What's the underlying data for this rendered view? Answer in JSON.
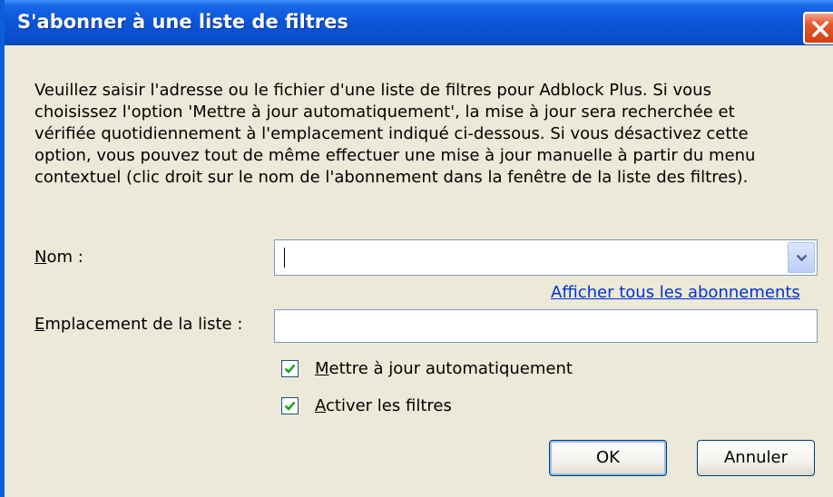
{
  "window": {
    "title": "S'abonner à une liste de filtres"
  },
  "description": {
    "lines": [
      "Veuillez saisir l'adresse ou le fichier d'une liste de filtres pour Adblock Plus. Si vous",
      "choisissez l'option 'Mettre à jour automatiquement', la mise à jour sera recherchée et",
      "vérifiée quotidiennement à l'emplacement indiqué ci-dessous. Si vous désactivez cette",
      "option, vous pouvez tout de même effectuer une mise à jour manuelle à partir du menu",
      "contextuel (clic droit sur le nom de l'abonnement dans la fenêtre de la liste des filtres)."
    ]
  },
  "form": {
    "name_label_accel": "N",
    "name_label_rest": "om :",
    "name_value": "",
    "show_all_link": "Afficher tous les abonnements",
    "location_label_accel": "E",
    "location_label_rest": "mplacement de la liste :",
    "location_value": ""
  },
  "options": {
    "auto_update": {
      "accel": "M",
      "rest": "ettre à jour automatiquement",
      "checked": true
    },
    "enable_filters": {
      "accel": "A",
      "rest": "ctiver les filtres",
      "checked": true
    }
  },
  "buttons": {
    "ok": "OK",
    "cancel": "Annuler"
  },
  "icons": {
    "close": "close-icon",
    "dropdown": "chevron-down-icon",
    "check": "checkmark-icon"
  },
  "colors": {
    "titlebar": "#0a55d7",
    "dialog_bg": "#ece9d8",
    "link": "#0033cc",
    "check": "#21a121",
    "close_button": "#e45a30"
  }
}
